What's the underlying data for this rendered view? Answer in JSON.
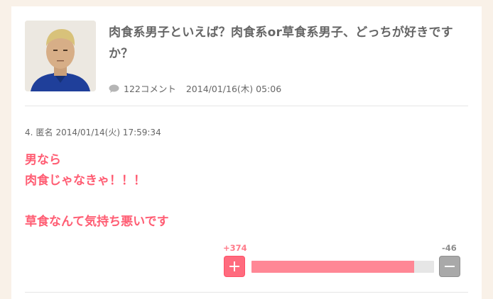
{
  "topic": {
    "title": "肉食系男子といえば？肉食系or草食系男子、どっちが好きですか？",
    "comment_count": "122コメント",
    "posted_at": "2014/01/16(木) 05:06",
    "thumbnail_icon": "person-photo-icon"
  },
  "comment": {
    "number": "4.",
    "author": "匿名",
    "posted_at": "2014/01/14(火) 17:59:34",
    "lines": [
      "男なら",
      "肉食じゃなきゃ！！！",
      "",
      "草食なんて気持ち悪いです"
    ],
    "vote": {
      "plus_label": "+374",
      "minus_label": "-46",
      "plus_count": 374,
      "minus_count": 46,
      "plus_ratio": 0.89
    }
  },
  "colors": {
    "accent_pink": "#ff5d73",
    "background": "#f9f1e8"
  }
}
